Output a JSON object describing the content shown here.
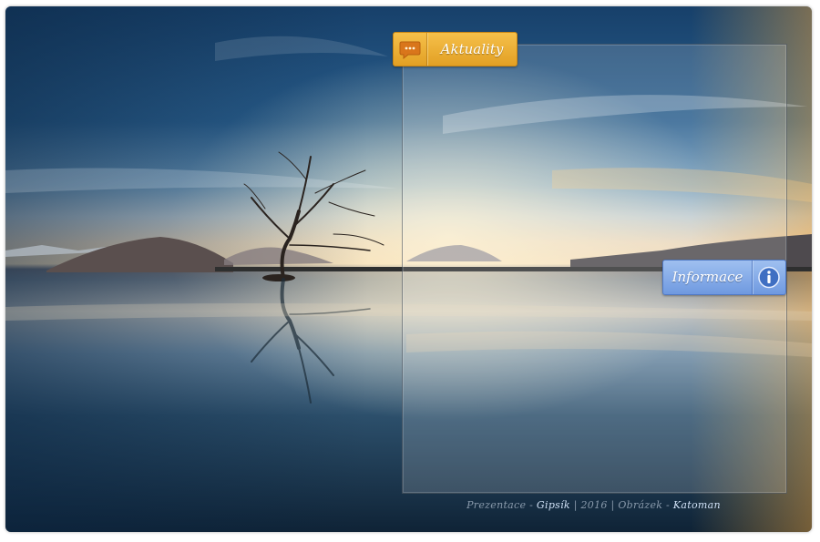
{
  "tabs": {
    "news": {
      "label": "Aktuality",
      "icon": "speech-bubble-icon"
    },
    "info": {
      "label": "Informace",
      "icon": "info-icon"
    }
  },
  "footer": {
    "prefix": "Prezentace - ",
    "author": "Gipsík",
    "sep1": " | 2016 | ",
    "image_label": "Obrázek",
    "sep2": " - ",
    "photographer": "Katoman"
  },
  "colors": {
    "news_tab": "#e9a82c",
    "info_tab": "#7ba2e4",
    "background_sky": "#1d4670"
  }
}
